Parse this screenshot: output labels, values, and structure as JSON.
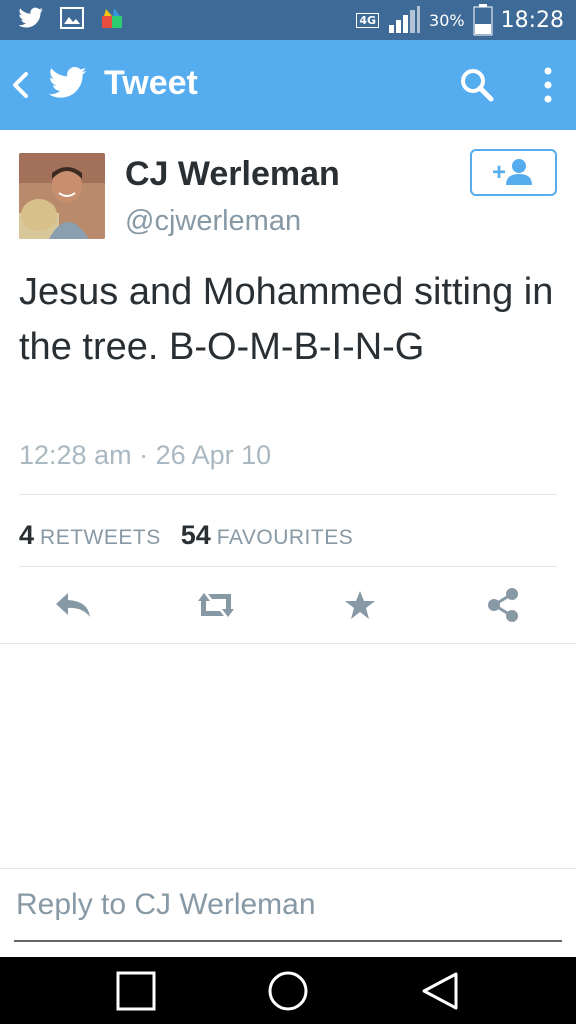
{
  "status_bar": {
    "network": "4G",
    "battery": "30%",
    "time": "18:28",
    "left_icons": [
      "twitter-icon",
      "gallery-icon",
      "app-icon"
    ]
  },
  "app_bar": {
    "title": "Tweet",
    "brand_color": "#55acee"
  },
  "tweet": {
    "author_name": "CJ Werleman",
    "author_handle": "@cjwerleman",
    "text": "Jesus and Mohammed sitting in the tree. B-O-M-B-I-N-G",
    "timestamp": "12:28 am · 26 Apr 10",
    "retweets_count": "4",
    "retweets_label": "RETWEETS",
    "favourites_count": "54",
    "favourites_label": "FAVOURITES"
  },
  "actions": [
    "reply-icon",
    "retweet-icon",
    "favourite-icon",
    "share-icon"
  ],
  "reply": {
    "placeholder": "Reply to CJ Werleman"
  },
  "nav_bar": [
    "recent-apps-icon",
    "home-icon",
    "back-nav-icon"
  ]
}
